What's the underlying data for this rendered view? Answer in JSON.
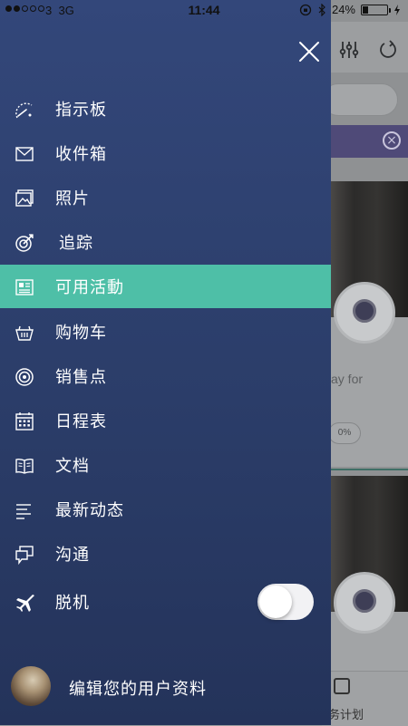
{
  "status_bar": {
    "carrier": "3",
    "network": "3G",
    "time": "11:44",
    "battery": "24%",
    "battery_level": 0.24
  },
  "drawer": {
    "background_colors": [
      "#33477a",
      "#24335a"
    ],
    "active_color": "#4ebfa7",
    "items": [
      {
        "label": "指示板",
        "icon": "dashboard-icon"
      },
      {
        "label": "收件箱",
        "icon": "inbox-icon"
      },
      {
        "label": "照片",
        "icon": "photos-icon"
      },
      {
        "label": "追踪",
        "icon": "target-icon"
      },
      {
        "label": "可用活動",
        "icon": "activities-icon",
        "active": true
      },
      {
        "label": "购物车",
        "icon": "cart-icon"
      },
      {
        "label": "销售点",
        "icon": "point-of-sale-icon"
      },
      {
        "label": "日程表",
        "icon": "calendar-icon"
      },
      {
        "label": "文档",
        "icon": "documents-icon"
      },
      {
        "label": "最新动态",
        "icon": "feed-icon"
      },
      {
        "label": "沟通",
        "icon": "chat-icon"
      },
      {
        "label": "脱机",
        "icon": "airplane-icon"
      }
    ],
    "offline_toggle_on": false,
    "profile_label": "编辑您的用户资料"
  },
  "background": {
    "visible_text": "ay for",
    "progress_pill": "0%",
    "tab_label": "务计划"
  }
}
